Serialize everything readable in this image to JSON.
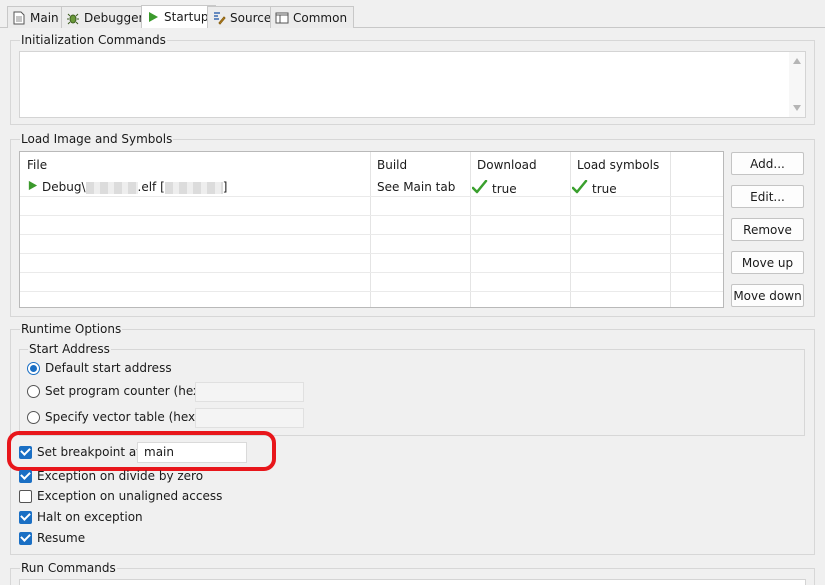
{
  "tabs": [
    {
      "label": "Main",
      "icon": "document-icon"
    },
    {
      "label": "Debugger",
      "icon": "bug-icon"
    },
    {
      "label": "Startup",
      "icon": "play-icon",
      "active": true
    },
    {
      "label": "Source",
      "icon": "source-icon"
    },
    {
      "label": "Common",
      "icon": "window-icon"
    }
  ],
  "init": {
    "label": "Initialization Commands",
    "value": ""
  },
  "load": {
    "label": "Load Image and Symbols",
    "columns": [
      "File",
      "Build",
      "Download",
      "Load symbols"
    ],
    "row": {
      "file_prefix": "Debug\\",
      "file_ext": ".elf [",
      "file_suffix": "]",
      "build": "See Main tab",
      "download": "true",
      "symbols": "true"
    },
    "buttons": {
      "add": "Add...",
      "edit": "Edit...",
      "remove": "Remove",
      "move_up": "Move up",
      "move_down": "Move down"
    }
  },
  "runtime": {
    "label": "Runtime Options",
    "start_address": {
      "label": "Start Address",
      "default": "Default start address",
      "set_pc": "Set program counter (hex):",
      "vector_table": "Specify vector table (hex):"
    },
    "breakpoint": {
      "label": "Set breakpoint at:",
      "value": "main",
      "checked": true
    },
    "divide_zero": {
      "label": "Exception on divide by zero",
      "checked": true
    },
    "unaligned": {
      "label": "Exception on unaligned access",
      "checked": false
    },
    "halt": {
      "label": "Halt on exception",
      "checked": true
    },
    "resume": {
      "label": "Resume",
      "checked": true
    }
  },
  "run": {
    "label": "Run Commands"
  },
  "colors": {
    "accent": "#1a6fc4",
    "highlight": "#e8161b",
    "check_green": "#3aa02e",
    "play_green": "#3b9a2c"
  }
}
